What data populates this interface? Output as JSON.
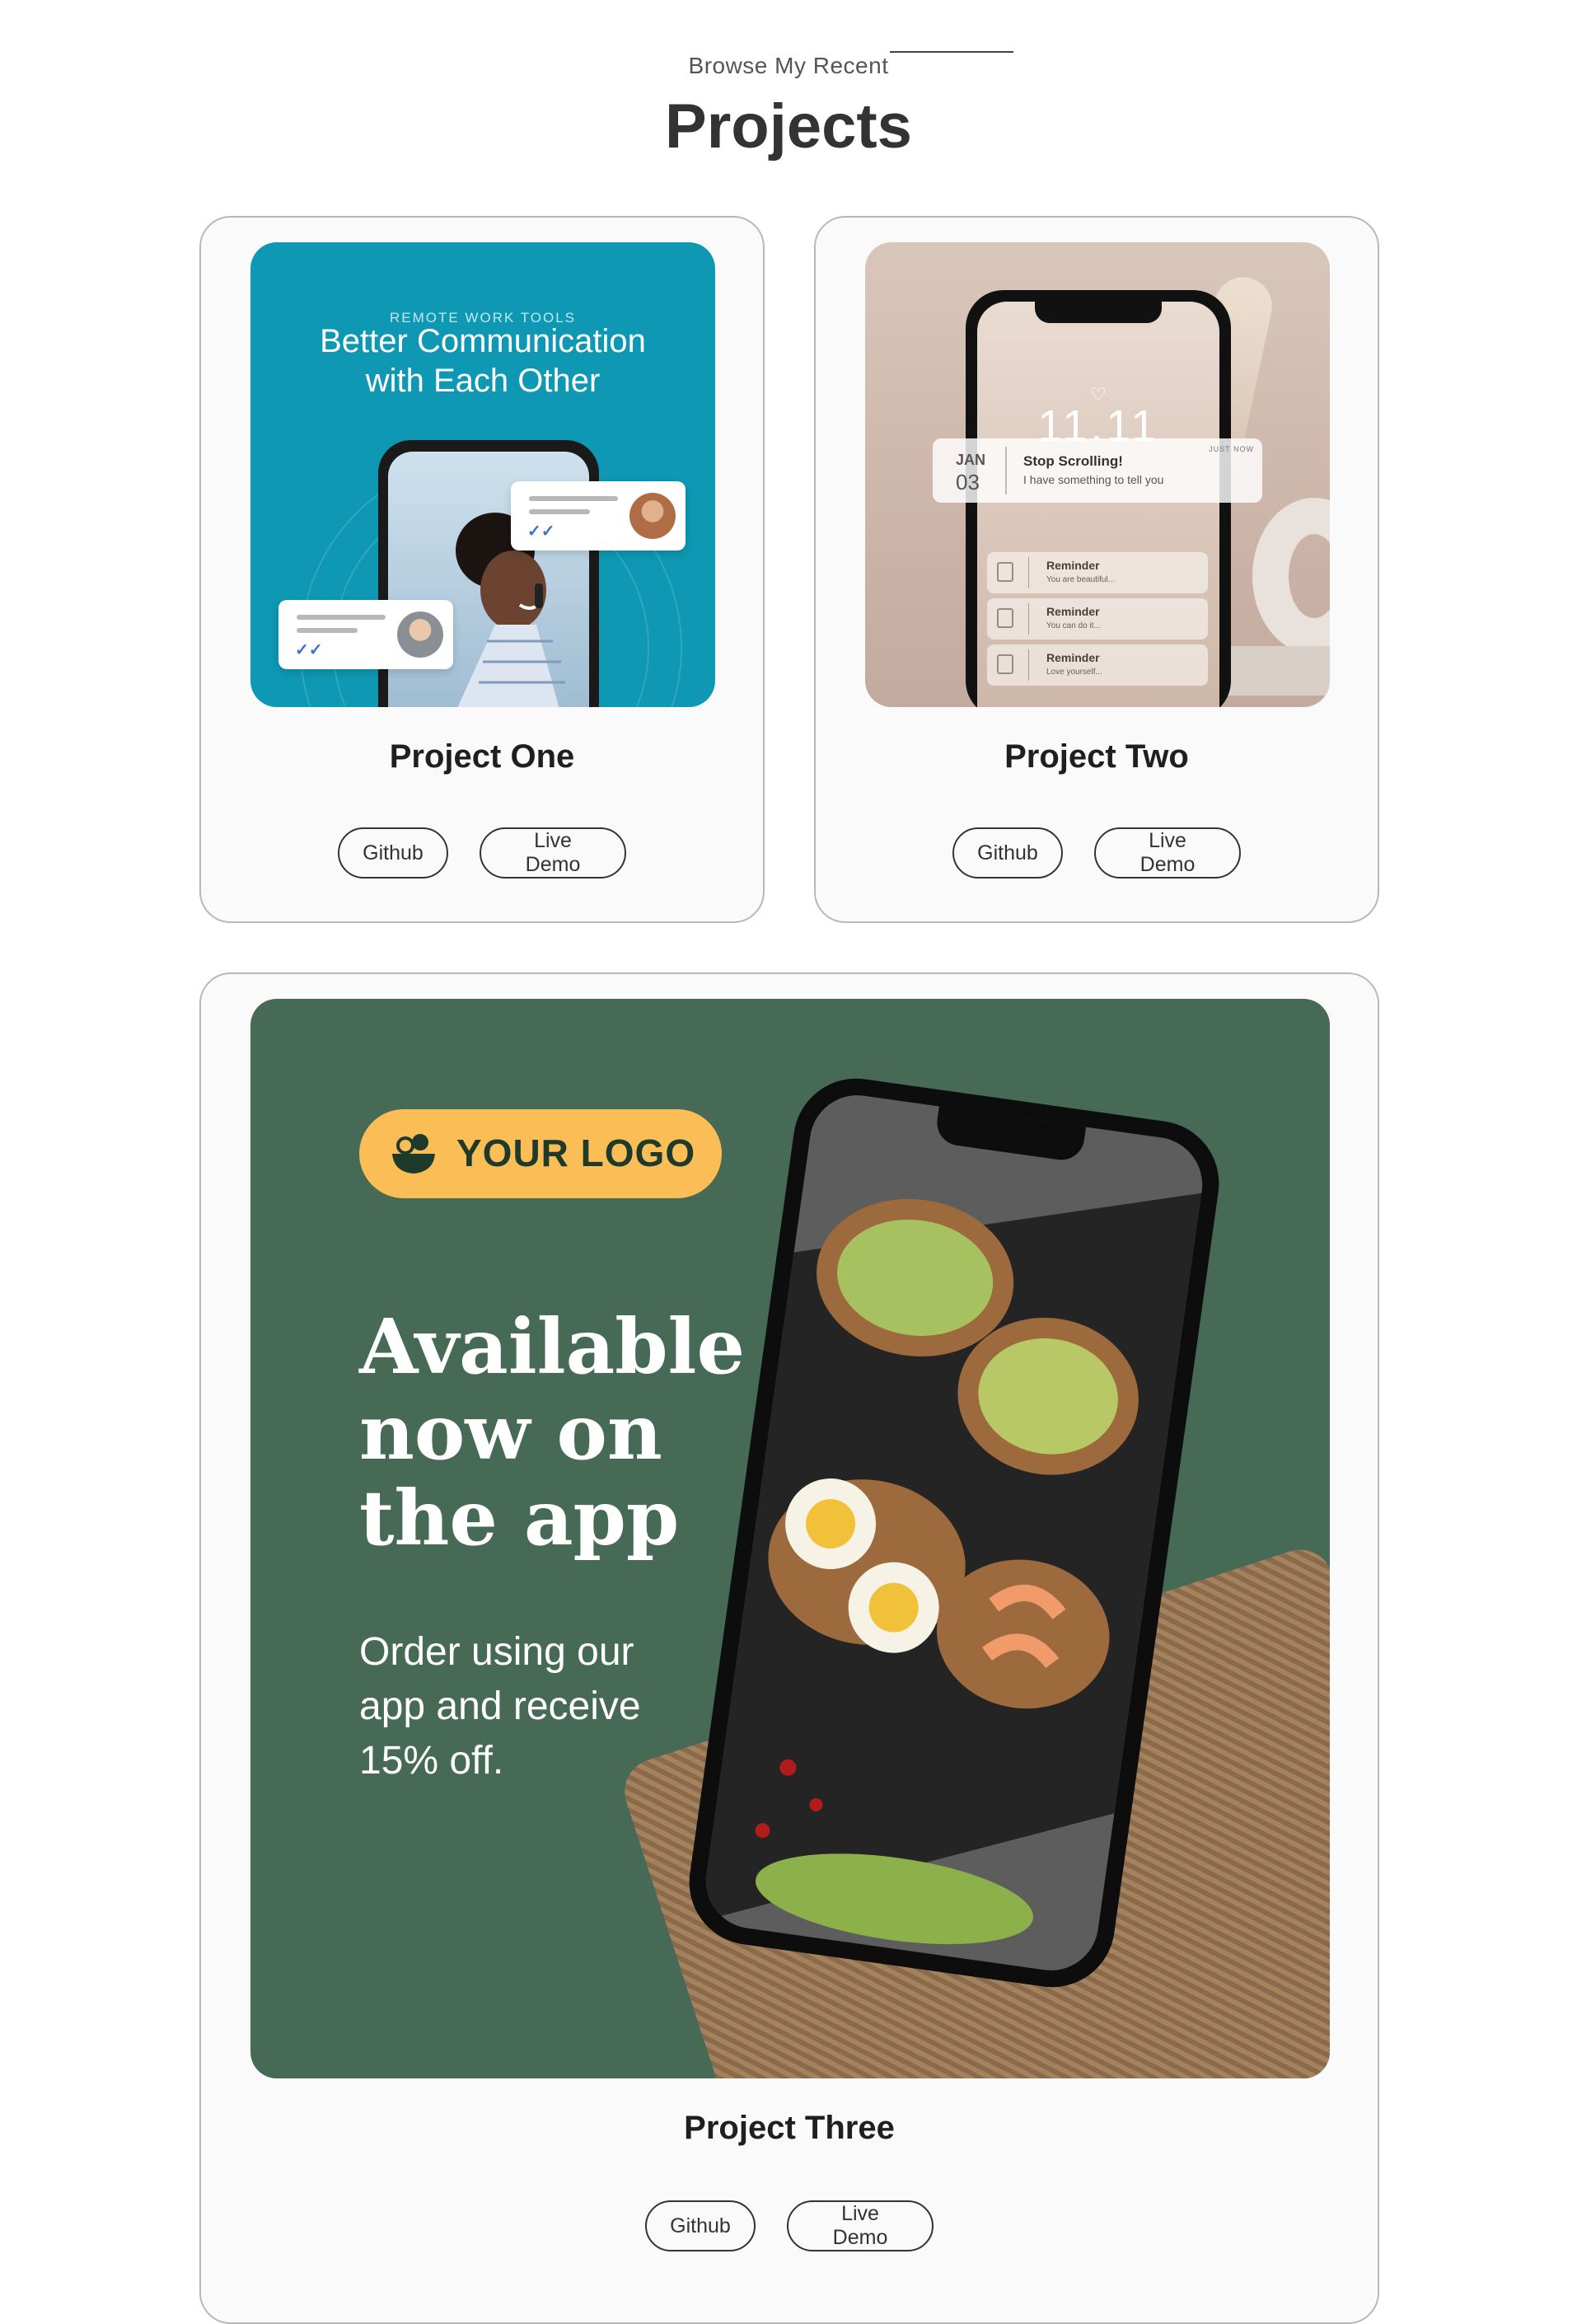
{
  "header": {
    "subtitle": "Browse My Recent",
    "title": "Projects"
  },
  "projects": [
    {
      "title": "Project One",
      "github_label": "Github",
      "demo_label": "Live Demo",
      "thumb": {
        "kicker": "REMOTE WORK TOOLS",
        "headline_line1": "Better Communication",
        "headline_line2": "with Each Other"
      }
    },
    {
      "title": "Project Two",
      "github_label": "Github",
      "demo_label": "Live Demo",
      "thumb": {
        "clock": "11.11",
        "notification": {
          "month": "JAN",
          "day": "03",
          "title": "Stop Scrolling!",
          "body": "I have something to tell you",
          "when": "JUST NOW"
        },
        "reminders": [
          {
            "title": "Reminder",
            "text": "You are beautiful..."
          },
          {
            "title": "Reminder",
            "text": "You can do it..."
          },
          {
            "title": "Reminder",
            "text": "Love yourself..."
          }
        ]
      }
    },
    {
      "title": "Project Three",
      "github_label": "Github",
      "demo_label": "Live Demo",
      "thumb": {
        "logo_text": "YOUR LOGO",
        "headline_line1": "Available",
        "headline_line2": "now on",
        "headline_line3": "the app",
        "body_line1": "Order using our",
        "body_line2": "app and receive",
        "body_line3": "15% off."
      }
    }
  ],
  "colors": {
    "accent_teal": "#0e98b3",
    "accent_green": "#466a55",
    "logo_yellow": "#fbbd56"
  }
}
